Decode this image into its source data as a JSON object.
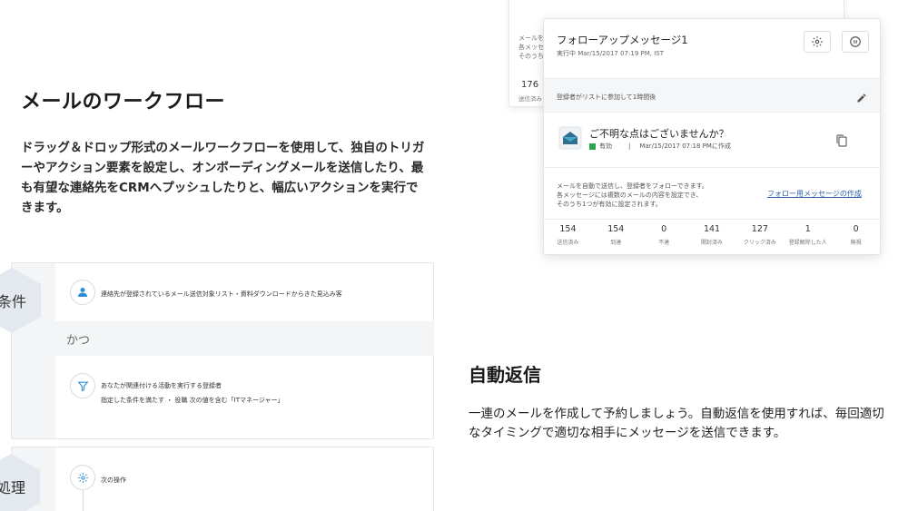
{
  "workflow_section": {
    "title": "メールのワークフロー",
    "body": "ドラッグ＆ドロップ形式のメールワークフローを使用して、独自のトリガーやアクション要素を設定し、オンボーディングメールを送信したり、最も有望な連絡先をCRMへプッシュしたりと、幅広いアクションを実行できます。"
  },
  "autoresponder_section": {
    "title": "自動返信",
    "body": "一連のメールを作成して予約しましょう。自動返信を使用すれば、毎回適切なタイミングで適切な相手にメッセージを送信できます。"
  },
  "back_card": {
    "desc": "メールを\n各メッセ\nそのうち",
    "stat_value": "176",
    "stat_label": "送信済み"
  },
  "followup_card": {
    "title": "フォローアップメッセージ1",
    "subtitle": "実行中 Mar/15/2017 07:19 PM, IST",
    "trigger": "登録者がリストに参加して1時間後",
    "message_title": "ご不明な点はございませんか？",
    "status": "有効",
    "created": "Mar/15/2017 07:18 PMに作成",
    "description": "メールを自動で送信し、登録者をフォローできます。\n各メッセージには複数のメールの内容を設定でき、\nそのうち1つが有効に設定されます。",
    "create_link": "フォロー用メッセージの作成",
    "stats": [
      {
        "value": "154",
        "label": "送信済み"
      },
      {
        "value": "154",
        "label": "到達"
      },
      {
        "value": "0",
        "label": "不達"
      },
      {
        "value": "141",
        "label": "開封済み"
      },
      {
        "value": "127",
        "label": "クリック済み"
      },
      {
        "value": "1",
        "label": "登録解除した人"
      },
      {
        "value": "0",
        "label": "無視"
      }
    ]
  },
  "conditions_panel": {
    "label": "条件",
    "condition1": "連絡先が登録されているメール送信対象リスト・資料ダウンロードからきた見込み客",
    "and_label": "かつ",
    "condition2_title": "あなたが関連付ける活動を実行する登録者",
    "condition2_detail": "指定した条件を満たす ・ 役職 次の値を含む「ITマネージャー」"
  },
  "process_panel": {
    "label": "処理",
    "action": "次の操作"
  },
  "colors": {
    "accent": "#2a8fd6",
    "status_green": "#2aa44f",
    "link": "#2b5fa8"
  }
}
